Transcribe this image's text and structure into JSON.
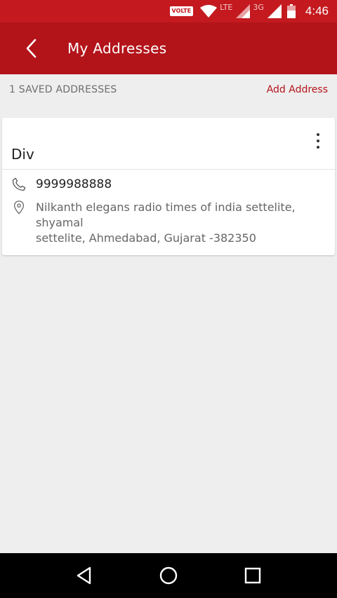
{
  "status_bar": {
    "volte": "VOLTE",
    "lte": "LTE",
    "network_3g": "3G",
    "time": "4:46"
  },
  "app_bar": {
    "title": "My Addresses",
    "back_icon": "chevron-left-icon"
  },
  "sub_header": {
    "saved_count": "1 SAVED ADDRESSES",
    "add_address": "Add Address"
  },
  "addresses": [
    {
      "name": "Div",
      "phone": "9999988888",
      "address_line1": "Nilkanth elegans radio times of india settelite,",
      "address_line2": "shyamal",
      "address_line3": "settelite, Ahmedabad, Gujarat -382350"
    }
  ],
  "nav_bar": {
    "icons": [
      "back-triangle-icon",
      "home-circle-icon",
      "recents-square-icon"
    ]
  },
  "colors": {
    "status_bar": "#c41a1f",
    "app_bar": "#b3141a",
    "accent": "#b3141a",
    "background": "#eeeeee"
  }
}
